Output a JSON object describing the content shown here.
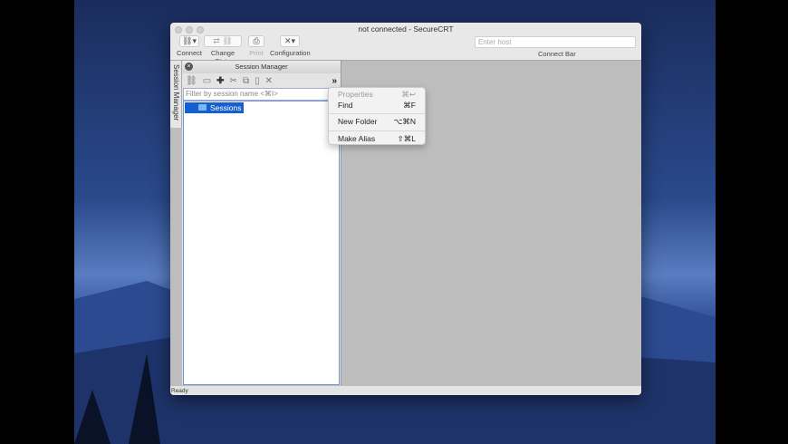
{
  "window": {
    "title": "not connected - SecureCRT"
  },
  "toolbar": {
    "connect": "Connect",
    "change_state": "Change State",
    "print": "Print",
    "configuration": "Configuration",
    "host_placeholder": "Enter host",
    "connect_bar": "Connect Bar"
  },
  "session_manager": {
    "tab_label": "Session Manager",
    "title": "Session Manager",
    "filter_placeholder": "Filter by session name <⌘I>",
    "tree": [
      {
        "label": "Sessions",
        "selected": true
      }
    ]
  },
  "context_menu": {
    "items": [
      {
        "label": "Properties",
        "shortcut": "⌘↩",
        "disabled": true
      },
      {
        "label": "Find",
        "shortcut": "⌘F"
      },
      {
        "label": "New Folder",
        "shortcut": "⌥⌘N"
      },
      {
        "label": "Make Alias",
        "shortcut": "⇧⌘L"
      }
    ]
  },
  "status": {
    "text": "Ready"
  },
  "colors": {
    "selection": "#1560d0",
    "content_bg": "#bdbdbd"
  }
}
